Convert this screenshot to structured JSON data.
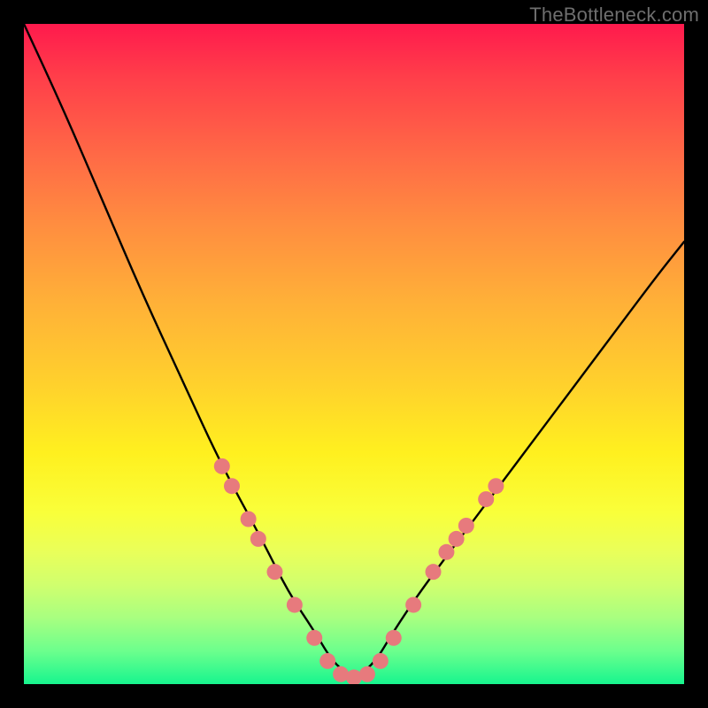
{
  "watermark": "TheBottleneck.com",
  "chart_data": {
    "type": "line",
    "title": "",
    "xlabel": "",
    "ylabel": "",
    "x_range": [
      0,
      100
    ],
    "y_range": [
      0,
      100
    ],
    "grid": false,
    "legend": false,
    "series": [
      {
        "name": "bottleneck-curve",
        "x": [
          0,
          6,
          12,
          18,
          24,
          30,
          36,
          40,
          44,
          47,
          50,
          53,
          56,
          60,
          66,
          72,
          78,
          84,
          90,
          96,
          100
        ],
        "y": [
          100,
          87,
          73,
          59,
          46,
          33,
          22,
          14,
          8,
          3,
          1,
          3,
          8,
          14,
          22,
          30,
          38,
          46,
          54,
          62,
          67
        ],
        "color": "#000000",
        "linewidth": 2.4
      }
    ],
    "markers": {
      "name": "highlight-dots",
      "color": "#e77a7d",
      "radius": 9,
      "points": [
        {
          "x": 30,
          "y": 33
        },
        {
          "x": 31.5,
          "y": 30
        },
        {
          "x": 34,
          "y": 25
        },
        {
          "x": 35.5,
          "y": 22
        },
        {
          "x": 38,
          "y": 17
        },
        {
          "x": 41,
          "y": 12
        },
        {
          "x": 44,
          "y": 7
        },
        {
          "x": 46,
          "y": 3.5
        },
        {
          "x": 48,
          "y": 1.5
        },
        {
          "x": 50,
          "y": 1
        },
        {
          "x": 52,
          "y": 1.5
        },
        {
          "x": 54,
          "y": 3.5
        },
        {
          "x": 56,
          "y": 7
        },
        {
          "x": 59,
          "y": 12
        },
        {
          "x": 62,
          "y": 17
        },
        {
          "x": 64,
          "y": 20
        },
        {
          "x": 65.5,
          "y": 22
        },
        {
          "x": 67,
          "y": 24
        },
        {
          "x": 70,
          "y": 28
        },
        {
          "x": 71.5,
          "y": 30
        }
      ]
    },
    "annotations": []
  }
}
